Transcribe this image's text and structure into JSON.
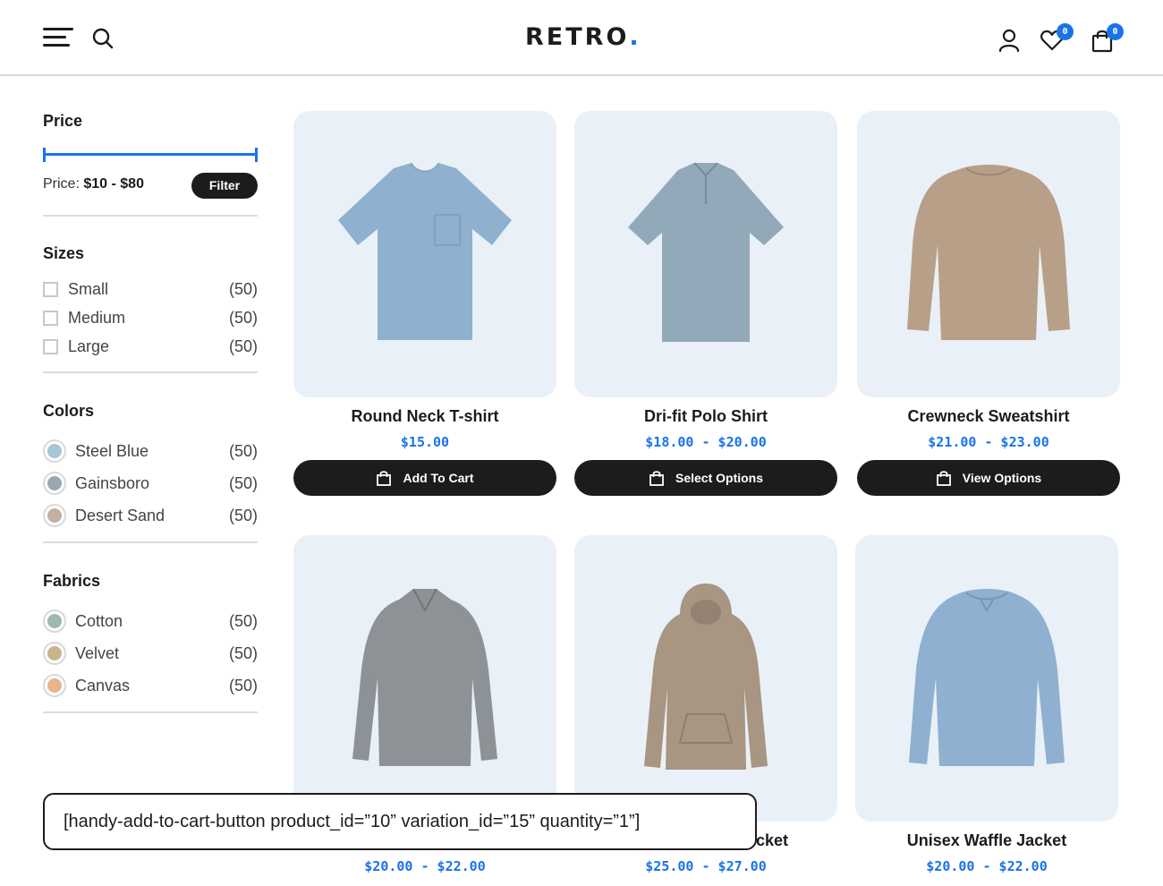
{
  "header": {
    "logo_text": "RETRO",
    "logo_dot": ".",
    "wishlist_count": "0",
    "cart_count": "0",
    "icons": [
      "menu-icon",
      "search-icon",
      "user-icon",
      "heart-icon",
      "shopping-bag-icon"
    ]
  },
  "sidebar": {
    "price": {
      "title": "Price",
      "label": "Price:",
      "range": "$10 - $80",
      "min": 10,
      "max": 80,
      "filter_label": "Filter"
    },
    "sizes": {
      "title": "Sizes",
      "items": [
        {
          "label": "Small",
          "count": "(50)"
        },
        {
          "label": "Medium",
          "count": "(50)"
        },
        {
          "label": "Large",
          "count": "(50)"
        }
      ]
    },
    "colors": {
      "title": "Colors",
      "items": [
        {
          "label": "Steel Blue",
          "count": "(50)",
          "color": "#a7c4d8"
        },
        {
          "label": "Gainsboro",
          "count": "(50)",
          "color": "#9aa6b0"
        },
        {
          "label": "Desert Sand",
          "count": "(50)",
          "color": "#c2b1a3"
        }
      ]
    },
    "fabrics": {
      "title": "Fabrics",
      "items": [
        {
          "label": "Cotton",
          "count": "(50)",
          "color": "#9fb8ad"
        },
        {
          "label": "Velvet",
          "count": "(50)",
          "color": "#c9b48c"
        },
        {
          "label": "Canvas",
          "count": "(50)",
          "color": "#e8b48c"
        }
      ]
    }
  },
  "products": [
    {
      "title": "Round Neck T-shirt",
      "price": "$15.00",
      "button": "Add To Cart",
      "color": "#8fb1cf"
    },
    {
      "title": "Dri-fit Polo Shirt",
      "price": "$18.00 - $20.00",
      "button": "Select Options",
      "color": "#92a9ba"
    },
    {
      "title": "Crewneck Sweatshirt",
      "price": "$21.00 - $23.00",
      "button": "View Options",
      "color": "#b89f88"
    },
    {
      "title": "",
      "price": "$20.00 - $22.00",
      "button": "",
      "color": "#8c9296"
    },
    {
      "title": "cket",
      "price": "$25.00 - $27.00",
      "button": "",
      "color": "#a89582"
    },
    {
      "title": "Unisex Waffle Jacket",
      "price": "$20.00 - $22.00",
      "button": "",
      "color": "#8fb0d0"
    }
  ],
  "shortcode": {
    "text": "[handy-add-to-cart-button product_id=”10” variation_id=”15” quantity=”1”]"
  },
  "colors": {
    "accent": "#1a73e8",
    "dark": "#1c1c1c",
    "card_bg": "#eaf0f7"
  }
}
